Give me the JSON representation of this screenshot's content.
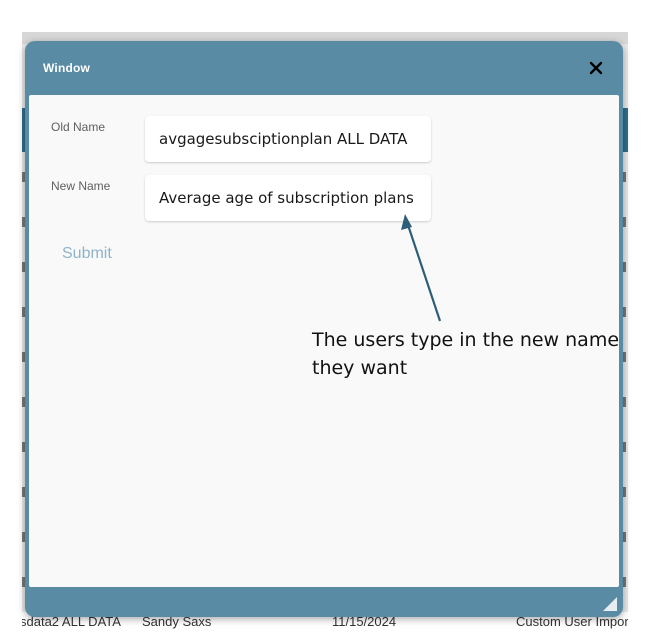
{
  "window": {
    "title": "Window",
    "close_glyph": "✕"
  },
  "form": {
    "old_name_label": "Old Name",
    "old_name_value": "avgagesubsciptionplan ALL DATA",
    "new_name_label": "New Name",
    "new_name_value": "Average age of subscription plans",
    "submit_label": "Submit"
  },
  "annotation": {
    "text": "The users type in the new name they want"
  },
  "background": {
    "bottom_row_cells": [
      "sdata2 ALL DATA",
      "Sandy Saxs",
      "11/15/2024",
      "Custom User Import"
    ]
  },
  "colors": {
    "window_frame": "#5a8ba5",
    "window_body": "#f9f9f9",
    "submit_text": "#8fb3c8",
    "arrow": "#2d5f78",
    "background_header": "#2f6e8c"
  },
  "icons": {
    "close": "close-icon",
    "resize": "resize-grip-icon",
    "arrow": "annotation-arrow"
  }
}
